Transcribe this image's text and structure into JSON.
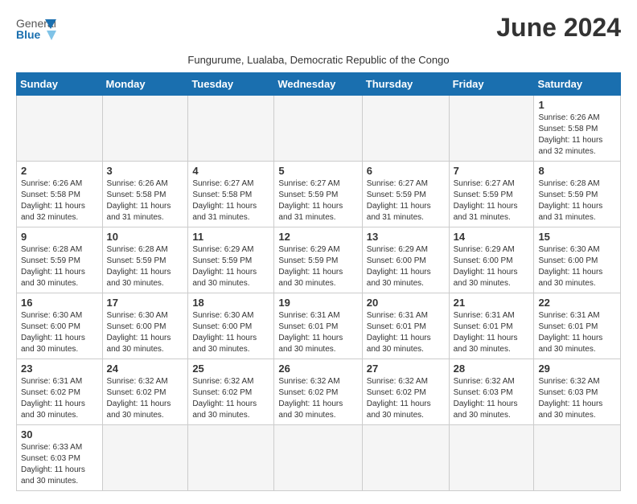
{
  "header": {
    "logo_general": "General",
    "logo_blue": "Blue",
    "month_title": "June 2024",
    "subtitle": "Fungurume, Lualaba, Democratic Republic of the Congo"
  },
  "weekdays": [
    "Sunday",
    "Monday",
    "Tuesday",
    "Wednesday",
    "Thursday",
    "Friday",
    "Saturday"
  ],
  "days": [
    {
      "num": "",
      "info": ""
    },
    {
      "num": "",
      "info": ""
    },
    {
      "num": "",
      "info": ""
    },
    {
      "num": "",
      "info": ""
    },
    {
      "num": "",
      "info": ""
    },
    {
      "num": "",
      "info": ""
    },
    {
      "num": "1",
      "info": "Sunrise: 6:26 AM\nSunset: 5:58 PM\nDaylight: 11 hours and 32 minutes."
    },
    {
      "num": "2",
      "info": "Sunrise: 6:26 AM\nSunset: 5:58 PM\nDaylight: 11 hours and 32 minutes."
    },
    {
      "num": "3",
      "info": "Sunrise: 6:26 AM\nSunset: 5:58 PM\nDaylight: 11 hours and 31 minutes."
    },
    {
      "num": "4",
      "info": "Sunrise: 6:27 AM\nSunset: 5:58 PM\nDaylight: 11 hours and 31 minutes."
    },
    {
      "num": "5",
      "info": "Sunrise: 6:27 AM\nSunset: 5:59 PM\nDaylight: 11 hours and 31 minutes."
    },
    {
      "num": "6",
      "info": "Sunrise: 6:27 AM\nSunset: 5:59 PM\nDaylight: 11 hours and 31 minutes."
    },
    {
      "num": "7",
      "info": "Sunrise: 6:27 AM\nSunset: 5:59 PM\nDaylight: 11 hours and 31 minutes."
    },
    {
      "num": "8",
      "info": "Sunrise: 6:28 AM\nSunset: 5:59 PM\nDaylight: 11 hours and 31 minutes."
    },
    {
      "num": "9",
      "info": "Sunrise: 6:28 AM\nSunset: 5:59 PM\nDaylight: 11 hours and 30 minutes."
    },
    {
      "num": "10",
      "info": "Sunrise: 6:28 AM\nSunset: 5:59 PM\nDaylight: 11 hours and 30 minutes."
    },
    {
      "num": "11",
      "info": "Sunrise: 6:29 AM\nSunset: 5:59 PM\nDaylight: 11 hours and 30 minutes."
    },
    {
      "num": "12",
      "info": "Sunrise: 6:29 AM\nSunset: 5:59 PM\nDaylight: 11 hours and 30 minutes."
    },
    {
      "num": "13",
      "info": "Sunrise: 6:29 AM\nSunset: 6:00 PM\nDaylight: 11 hours and 30 minutes."
    },
    {
      "num": "14",
      "info": "Sunrise: 6:29 AM\nSunset: 6:00 PM\nDaylight: 11 hours and 30 minutes."
    },
    {
      "num": "15",
      "info": "Sunrise: 6:30 AM\nSunset: 6:00 PM\nDaylight: 11 hours and 30 minutes."
    },
    {
      "num": "16",
      "info": "Sunrise: 6:30 AM\nSunset: 6:00 PM\nDaylight: 11 hours and 30 minutes."
    },
    {
      "num": "17",
      "info": "Sunrise: 6:30 AM\nSunset: 6:00 PM\nDaylight: 11 hours and 30 minutes."
    },
    {
      "num": "18",
      "info": "Sunrise: 6:30 AM\nSunset: 6:00 PM\nDaylight: 11 hours and 30 minutes."
    },
    {
      "num": "19",
      "info": "Sunrise: 6:31 AM\nSunset: 6:01 PM\nDaylight: 11 hours and 30 minutes."
    },
    {
      "num": "20",
      "info": "Sunrise: 6:31 AM\nSunset: 6:01 PM\nDaylight: 11 hours and 30 minutes."
    },
    {
      "num": "21",
      "info": "Sunrise: 6:31 AM\nSunset: 6:01 PM\nDaylight: 11 hours and 30 minutes."
    },
    {
      "num": "22",
      "info": "Sunrise: 6:31 AM\nSunset: 6:01 PM\nDaylight: 11 hours and 30 minutes."
    },
    {
      "num": "23",
      "info": "Sunrise: 6:31 AM\nSunset: 6:02 PM\nDaylight: 11 hours and 30 minutes."
    },
    {
      "num": "24",
      "info": "Sunrise: 6:32 AM\nSunset: 6:02 PM\nDaylight: 11 hours and 30 minutes."
    },
    {
      "num": "25",
      "info": "Sunrise: 6:32 AM\nSunset: 6:02 PM\nDaylight: 11 hours and 30 minutes."
    },
    {
      "num": "26",
      "info": "Sunrise: 6:32 AM\nSunset: 6:02 PM\nDaylight: 11 hours and 30 minutes."
    },
    {
      "num": "27",
      "info": "Sunrise: 6:32 AM\nSunset: 6:02 PM\nDaylight: 11 hours and 30 minutes."
    },
    {
      "num": "28",
      "info": "Sunrise: 6:32 AM\nSunset: 6:03 PM\nDaylight: 11 hours and 30 minutes."
    },
    {
      "num": "29",
      "info": "Sunrise: 6:32 AM\nSunset: 6:03 PM\nDaylight: 11 hours and 30 minutes."
    },
    {
      "num": "30",
      "info": "Sunrise: 6:33 AM\nSunset: 6:03 PM\nDaylight: 11 hours and 30 minutes."
    },
    {
      "num": "",
      "info": ""
    },
    {
      "num": "",
      "info": ""
    },
    {
      "num": "",
      "info": ""
    },
    {
      "num": "",
      "info": ""
    },
    {
      "num": "",
      "info": ""
    },
    {
      "num": "",
      "info": ""
    }
  ]
}
